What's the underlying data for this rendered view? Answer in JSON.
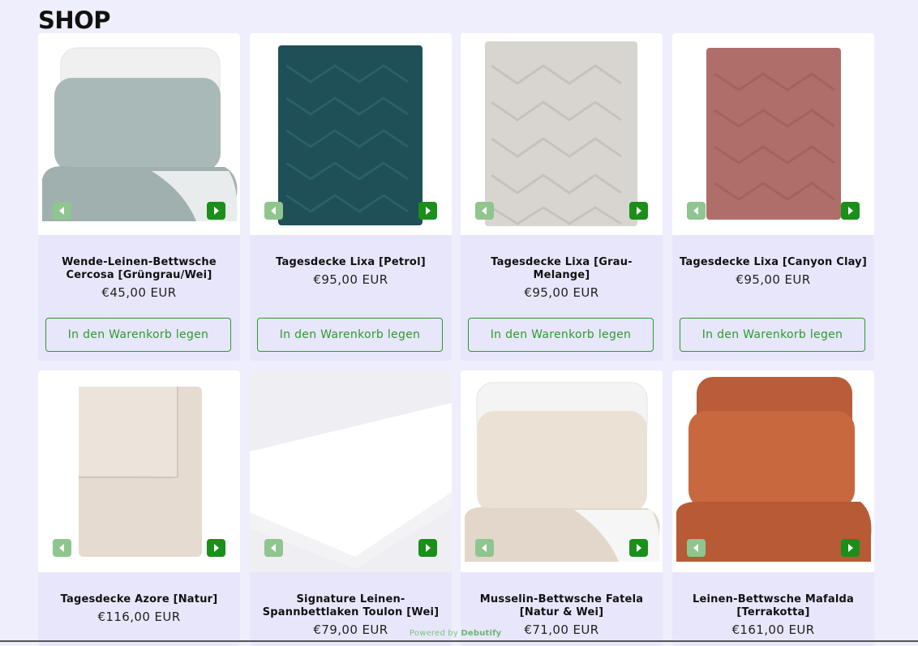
{
  "shop": {
    "title": "SHOP"
  },
  "arrows": {
    "prev_icon": "chevron-left-icon",
    "next_icon": "chevron-right-icon"
  },
  "colors": {
    "accent": "#1a8f1a",
    "accent_light": "#8fc58f",
    "card_bg": "#e8e6fb",
    "page_bg": "#efeefc"
  },
  "products": [
    {
      "title": "Wende-Leinen-Bettwsche Cercosa [Grüngrau/Wei]",
      "price": "€45,00 EUR",
      "button": "In den Warenkorb legen"
    },
    {
      "title": "Tagesdecke Lixa [Petrol]",
      "price": "€95,00 EUR",
      "button": "In den Warenkorb legen"
    },
    {
      "title": "Tagesdecke Lixa [Grau-Melange]",
      "price": "€95,00 EUR",
      "button": "In den Warenkorb legen"
    },
    {
      "title": "Tagesdecke Lixa [Canyon Clay]",
      "price": "€95,00 EUR",
      "button": "In den Warenkorb legen"
    },
    {
      "title": "Tagesdecke Azore [Natur]",
      "price": "€116,00 EUR"
    },
    {
      "title": "Signature Leinen-Spannbettlaken Toulon [Wei]",
      "price": "€79,00 EUR"
    },
    {
      "title": "Musselin-Bettwsche Fatela [Natur & Wei]",
      "price": "€71,00 EUR"
    },
    {
      "title": "Leinen-Bettwsche Mafalda [Terrakotta]",
      "price": "€161,00 EUR"
    }
  ],
  "footer": {
    "powered_prefix": "Powered by",
    "powered_brand": "Debutify"
  }
}
